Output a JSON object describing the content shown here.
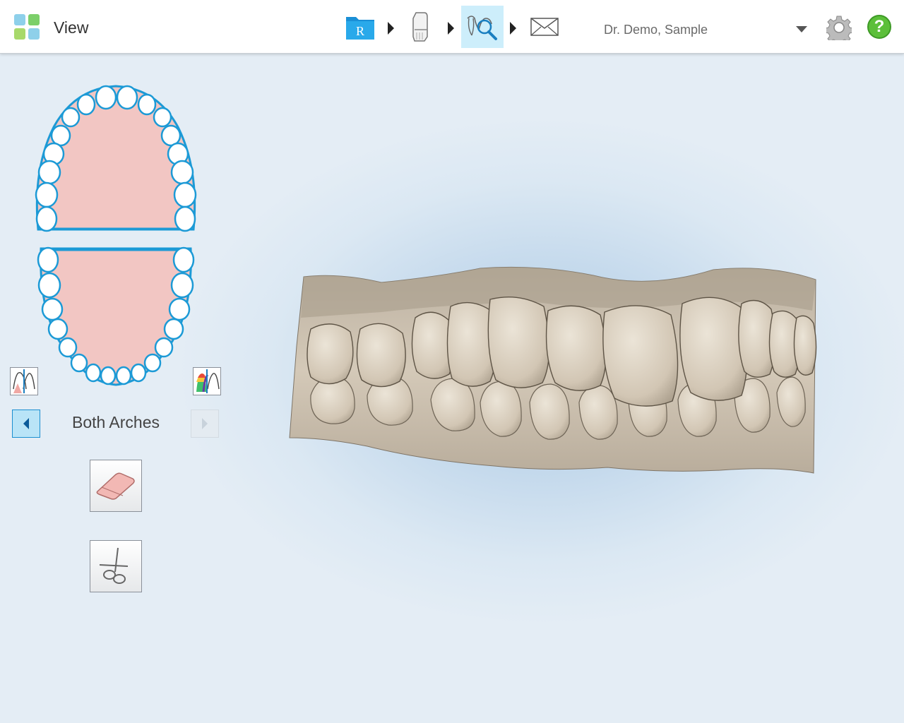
{
  "header": {
    "title": "View",
    "doctor_name": "Dr. Demo, Sample",
    "workflow_steps": [
      {
        "name": "Rx",
        "icon": "rx-folder-icon",
        "label": "R"
      },
      {
        "name": "Scan",
        "icon": "scanner-wand-icon"
      },
      {
        "name": "View",
        "icon": "view-model-icon",
        "active": true
      },
      {
        "name": "Send",
        "icon": "envelope-icon"
      }
    ],
    "help_label": "?"
  },
  "left_panel": {
    "arch_label": "Both Arches",
    "tools": [
      {
        "name": "eraser",
        "icon": "eraser-icon"
      },
      {
        "name": "trim",
        "icon": "scissors-icon"
      }
    ]
  },
  "colors": {
    "accent": "#1c9ad6",
    "gum": "#f2c6c3",
    "model": "#d3c8b6",
    "help": "#5cbf3a"
  }
}
